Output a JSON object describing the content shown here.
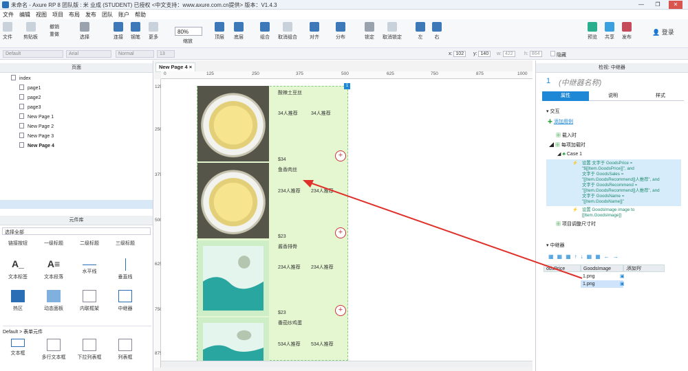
{
  "window": {
    "title": "未命名 - Axure RP 8 团队版 : 米 业成 (STUDENT) 已授权    <中文支持：www.axure.com.cn提供> 版本：V1.4.3"
  },
  "menu": [
    "文件",
    "编辑",
    "视图",
    "项目",
    "布局",
    "发布",
    "团队",
    "账户",
    "帮助"
  ],
  "toolbar": {
    "file": "文件",
    "clipboard": "剪贴板",
    "cut": "剪切",
    "copy": "复制",
    "paste": "粘贴",
    "undo": "撤销",
    "redo": "重做",
    "select": "选择",
    "connect": "连接",
    "pen": "钢笔",
    "more": "更多",
    "zoom": "80%",
    "zoom_label": "缩放",
    "top": "顶层",
    "bottom": "底层",
    "group": "组合",
    "ungroup": "取消组合",
    "align": "对齐",
    "distribute": "分布",
    "lock": "锁定",
    "unlock": "取消锁定",
    "left": "左",
    "right": "右",
    "preview": "预览",
    "share": "共享",
    "publish": "发布",
    "login": "登录"
  },
  "format": {
    "style": "Default",
    "font": "Arial",
    "weight": "Normal",
    "size": "13",
    "x_label": "x:",
    "x": "102",
    "y_label": "y:",
    "y": "140",
    "w_label": "w:",
    "w": "422",
    "h_label": "h:",
    "h": "864",
    "hide": "隐藏"
  },
  "pages": {
    "header": "页面",
    "root": "index",
    "items": [
      "page1",
      "page2",
      "page3",
      "New Page 1",
      "New Page 2",
      "New Page 3",
      "New Page 4"
    ]
  },
  "library": {
    "header": "元件库",
    "filter": "选择全部",
    "row0": [
      "链接按钮",
      "一级标题",
      "二级标题",
      "三级标题"
    ],
    "row1": [
      "文本标签",
      "文本段落",
      "水平线",
      "垂直线"
    ],
    "row2": [
      "热区",
      "动态面板",
      "内联框架",
      "中继器"
    ],
    "section": "Default > 表单元件",
    "row3": [
      "文本框",
      "多行文本框",
      "下拉列表框",
      "列表框"
    ]
  },
  "canvas": {
    "tab": "New Page 4",
    "hticks": [
      "0",
      "125",
      "250",
      "375",
      "500",
      "625",
      "750",
      "875",
      "1000"
    ],
    "vticks": [
      "125",
      "250",
      "375",
      "500",
      "625",
      "750",
      "875"
    ],
    "badge": "1",
    "items": [
      {
        "name": "酸辣土豆丝",
        "sales": "34人推荐",
        "recommend": "34人推荐"
      },
      {
        "price": "$34",
        "name": "鱼香肉丝",
        "sales": "234人推荐",
        "recommend": "234人推荐"
      },
      {
        "price": "$23",
        "name": "酱香排骨",
        "sales": "234人推荐",
        "recommend": "234人推荐"
      },
      {
        "price": "$23",
        "name": "番茄炒鸡蛋",
        "sales": "534人推荐",
        "recommend": "534人推荐"
      }
    ],
    "plus": "+"
  },
  "inspector": {
    "header": "检视: 中继器",
    "index": "1",
    "name": "(中继器名称)",
    "tabs": [
      "属性",
      "说明",
      "样式"
    ],
    "interaction": "交互",
    "add_case": "添加用例",
    "events": [
      "载入时",
      "每项加载时",
      "Case 1",
      "项目调整尺寸时"
    ],
    "action1": [
      "设置 文字于 GoodsPrice =",
      "\"$[[Item.GoodsPrice]]\", and",
      "文字于 GoodsSales =",
      "\"[[Item.GoodsRecommend]]人推荐\", and",
      "文字于 GoodsRecommend =",
      "\"[[Item.GoodsRecommend]]人推荐\", and",
      "文字于 GoodsName =",
      "\"[[Item.GoodsName]]\""
    ],
    "action2": [
      "设置 GoodsImage image to",
      "[[Item.GoodsImage]]"
    ],
    "repeater_label": "中继器",
    "columns": [
      "odsPrice",
      "GoodsImage",
      "添加列"
    ],
    "rows": [
      "1.png",
      "1.png"
    ]
  },
  "colors": {
    "accent": "#1e88d6",
    "arrow": "#e0302a",
    "repeater": "#e5f7d1"
  }
}
